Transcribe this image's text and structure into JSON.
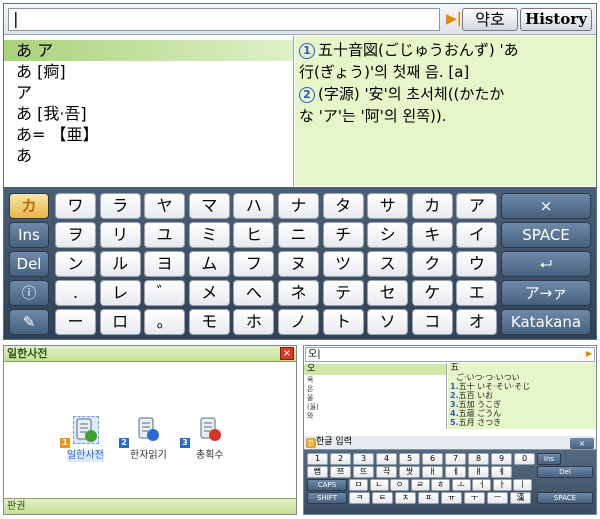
{
  "main": {
    "search_value": "|",
    "abbr_label": "약호",
    "history_label": "History",
    "word_list": [
      "あ ア",
      "あ [痾]",
      "ア",
      "あ [我·吾]",
      "あ= 【亜】",
      "あ"
    ],
    "definition": {
      "n1": "1",
      "line1": "五十音図(ごじゅうおんず) 'あ",
      "line2": "行(ぎょう)'의 첫째 음. [a]",
      "n2": "2",
      "line3": "(字源) '安'의 초서체((かたか",
      "line4": "な 'ア'는 '阿'의 왼쪽))."
    },
    "keyboard": {
      "kana_label": "カ",
      "row1": [
        "ワ",
        "ラ",
        "ヤ",
        "マ",
        "ハ",
        "ナ",
        "タ",
        "サ",
        "カ",
        "ア"
      ],
      "row2": [
        "ヲ",
        "リ",
        "ユ",
        "ミ",
        "ヒ",
        "ニ",
        "チ",
        "シ",
        "キ",
        "イ"
      ],
      "row3": [
        "ン",
        "ル",
        "ヨ",
        "ム",
        "フ",
        "ヌ",
        "ツ",
        "ス",
        "ク",
        "ウ"
      ],
      "row4": [
        ".",
        "レ",
        "゛",
        "メ",
        "へ",
        "ネ",
        "テ",
        "セ",
        "ケ",
        "エ"
      ],
      "row5": [
        "ー",
        "ロ",
        "。",
        "モ",
        "ホ",
        "ノ",
        "ト",
        "ソ",
        "コ",
        "オ"
      ],
      "ins_label": "Ins",
      "del_label": "Del",
      "space_label": "SPACE",
      "close_label": "×",
      "enter_label": "⮠",
      "small_label": "ア→ァ",
      "katakana_label": "Katakana"
    }
  },
  "left_app": {
    "title": "일한사전",
    "close_label": "×",
    "menu": [
      {
        "num": "1",
        "label": "일한사전"
      },
      {
        "num": "2",
        "label": "한자읽기"
      },
      {
        "num": "3",
        "label": "총획수"
      }
    ],
    "status": "판권"
  },
  "right_app": {
    "search_value": "오|",
    "list": [
      "오",
      "옥",
      "온",
      "올",
      "(옳)",
      "와"
    ],
    "def_head": "五",
    "def_reading": "ご·いつ·つ·いつい",
    "defs": [
      {
        "n": "1.",
        "text": "五十 いそ·そい·そじ"
      },
      {
        "n": "2.",
        "text": "五百 いお"
      },
      {
        "n": "3.",
        "text": "五加 うこぎ"
      },
      {
        "n": "4.",
        "text": "五蘊 ごうん"
      },
      {
        "n": "5.",
        "text": "五月 さつき"
      }
    ],
    "ime_label": "한글 입력",
    "ime_icon": "한",
    "close_label": "×",
    "keys": {
      "row1": [
        "1",
        "2",
        "3",
        "4",
        "5",
        "6",
        "7",
        "8",
        "9",
        "0"
      ],
      "row2": [
        "뻡",
        "쯔",
        "뜨",
        "끅",
        "쌋",
        "ㅐ",
        "ㅔ",
        "ㅒ",
        "ㅖ"
      ],
      "row3": [
        "ㅂ",
        "ㅈ",
        "ㄷ",
        "ㄱ",
        "ㅅ",
        "ㅛ",
        "ㅕ",
        "ㅑ",
        "ㅐ",
        "ㅔ"
      ],
      "row4": [
        "ㅁ",
        "ㄴ",
        "ㅇ",
        "ㄹ",
        "ㅎ",
        "ㅗ",
        "ㅓ",
        "ㅏ",
        "ㅣ"
      ],
      "row5": [
        "ㅋ",
        "ㅌ",
        "ㅊ",
        "ㅍ",
        "ㅠ",
        "ㅜ",
        "ㅡ",
        "漢"
      ],
      "ins": "Ins",
      "del": "Del",
      "caps": "CAPS",
      "shift": "SHIFT",
      "space": "SPACE"
    }
  }
}
